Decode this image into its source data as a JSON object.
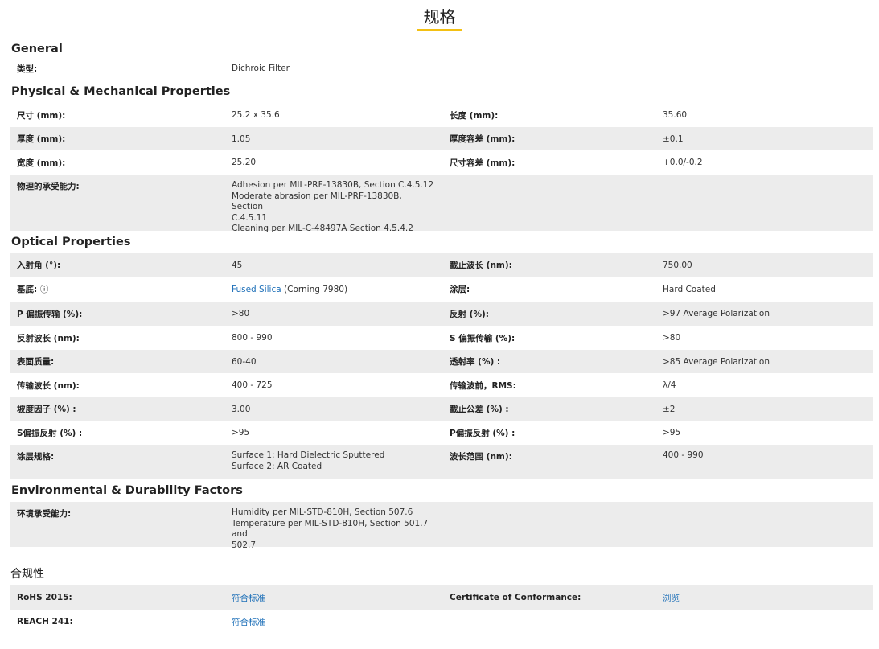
{
  "page_title": "规格",
  "sections": {
    "general": {
      "heading": "General",
      "type_label": "类型:",
      "type_value": "Dichroic Filter"
    },
    "physical": {
      "heading": "Physical & Mechanical Properties",
      "rows": [
        {
          "l1": "尺寸 (mm):",
          "v1": "25.2 x 35.6",
          "l2": "长度 (mm):",
          "v2": "35.60"
        },
        {
          "l1": "厚度 (mm):",
          "v1": "1.05",
          "l2": "厚度容差 (mm):",
          "v2": "±0.1"
        },
        {
          "l1": "宽度 (mm):",
          "v1": "25.20",
          "l2": "尺寸容差 (mm):",
          "v2": "+0.0/-0.2"
        }
      ],
      "durability_label": "物理的承受能力:",
      "durability_lines": [
        "Adhesion per MIL-PRF-13830B, Section C.4.5.12",
        "Moderate abrasion per MIL-PRF-13830B, Section",
        "C.4.5.11",
        "Cleaning per MIL-C-48497A Section 4.5.4.2"
      ]
    },
    "optical": {
      "heading": "Optical Properties",
      "aoi_label": "入射角 (°):",
      "aoi_value": "45",
      "cutoff_label": "截止波长 (nm):",
      "cutoff_value": "750.00",
      "substrate_label": "基底:",
      "substrate_info_icon": "ⓘ",
      "substrate_link": "Fused Silica",
      "substrate_suffix": " (Corning 7980)",
      "coating_label": "涂层:",
      "coating_value": "Hard Coated",
      "rows": [
        {
          "l1": "P 偏振传输 (%):",
          "v1": ">80",
          "l2": "反射 (%):",
          "v2": ">97 Average Polarization"
        },
        {
          "l1": "反射波长 (nm):",
          "v1": "800 - 990",
          "l2": "S 偏振传输 (%):",
          "v2": ">80"
        },
        {
          "l1": "表面质量:",
          "v1": "60-40",
          "l2": "透射率 (%) :",
          "v2": ">85 Average Polarization"
        },
        {
          "l1": "传输波长 (nm):",
          "v1": "400 - 725",
          "l2": "传输波前，RMS:",
          "v2": "λ/4"
        },
        {
          "l1": "坡度因子 (%) :",
          "v1": "3.00",
          "l2": "截止公差 (%) :",
          "v2": "±2"
        },
        {
          "l1": "S偏振反射 (%) :",
          "v1": ">95",
          "l2": "P偏振反射 (%) :",
          "v2": ">95"
        }
      ],
      "coating_spec_label": "涂层规格:",
      "coating_spec_lines": [
        "Surface 1: Hard Dielectric Sputtered",
        "Surface 2: AR Coated"
      ],
      "wavelength_range_label": "波长范围 (nm):",
      "wavelength_range_value": "400 - 990"
    },
    "environmental": {
      "heading": "Environmental & Durability Factors",
      "label": "环境承受能力:",
      "lines": [
        "Humidity per MIL-STD-810H, Section 507.6",
        "Temperature per MIL-STD-810H, Section 501.7 and",
        "502.7"
      ]
    },
    "compliance": {
      "heading": "合规性",
      "rohs_label": "RoHS 2015:",
      "rohs_link": "符合标准",
      "coc_label": "Certificate of Conformance:",
      "coc_link": "浏览",
      "reach_label": "REACH 241:",
      "reach_link": "符合标准"
    }
  },
  "colors": {
    "accent": "#f3c013",
    "link": "#1d6fb8",
    "row_shade": "#ececec"
  }
}
